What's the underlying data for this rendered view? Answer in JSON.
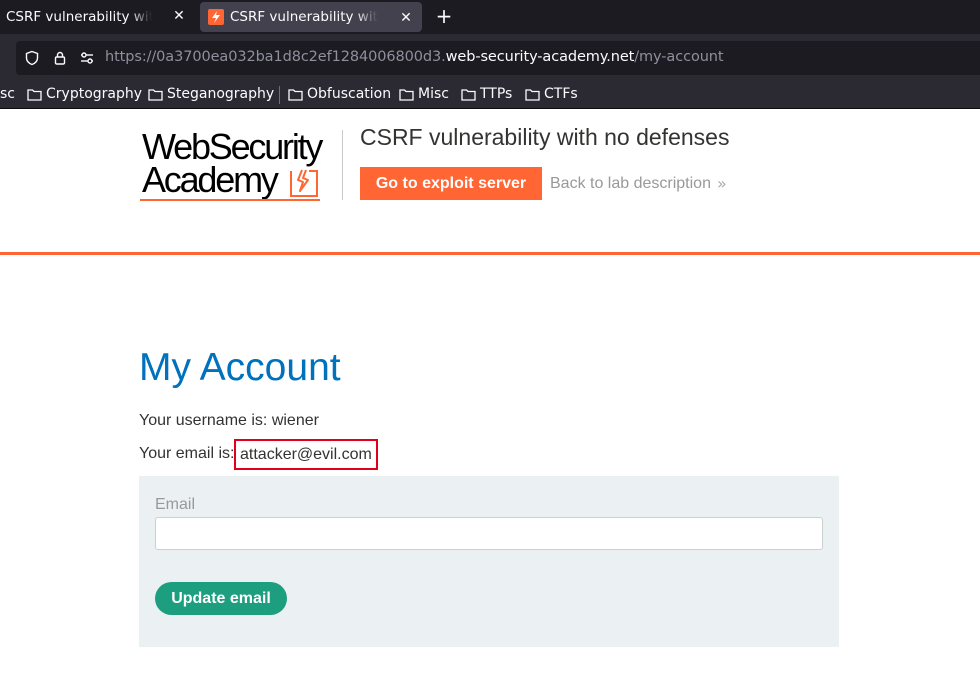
{
  "browser": {
    "tabs": [
      {
        "title": "CSRF vulnerability with no defenses",
        "active": false
      },
      {
        "title": "CSRF vulnerability with no defenses",
        "active": true
      }
    ],
    "new_tab_icon": "plus-icon",
    "url": {
      "prefix": "https://0a3700ea032ba1d8c2ef1284006800d3.",
      "domain": "web-security-academy.net",
      "path": "/my-account"
    },
    "bookmarks": [
      "sc",
      "Cryptography",
      "Steganography",
      "Obfuscation",
      "Misc",
      "TTPs",
      "CTFs"
    ]
  },
  "header": {
    "logo_line1": "WebSecurity",
    "logo_line2": "Academy",
    "lab_title": "CSRF vulnerability with no defenses",
    "exploit_button": "Go to exploit server",
    "back_link": "Back to lab description",
    "back_chevron": "»"
  },
  "account": {
    "heading": "My Account",
    "username_line": "Your username is: wiener",
    "email_label": "Your email is:",
    "email_value": "attacker@evil.com",
    "form": {
      "email_label": "Email",
      "email_value": "",
      "update_button": "Update email"
    }
  },
  "colors": {
    "accent_orange": "#ff6633",
    "heading_blue": "#0071bc",
    "button_green": "#1c9e7f",
    "highlight_red": "#e0001a"
  }
}
